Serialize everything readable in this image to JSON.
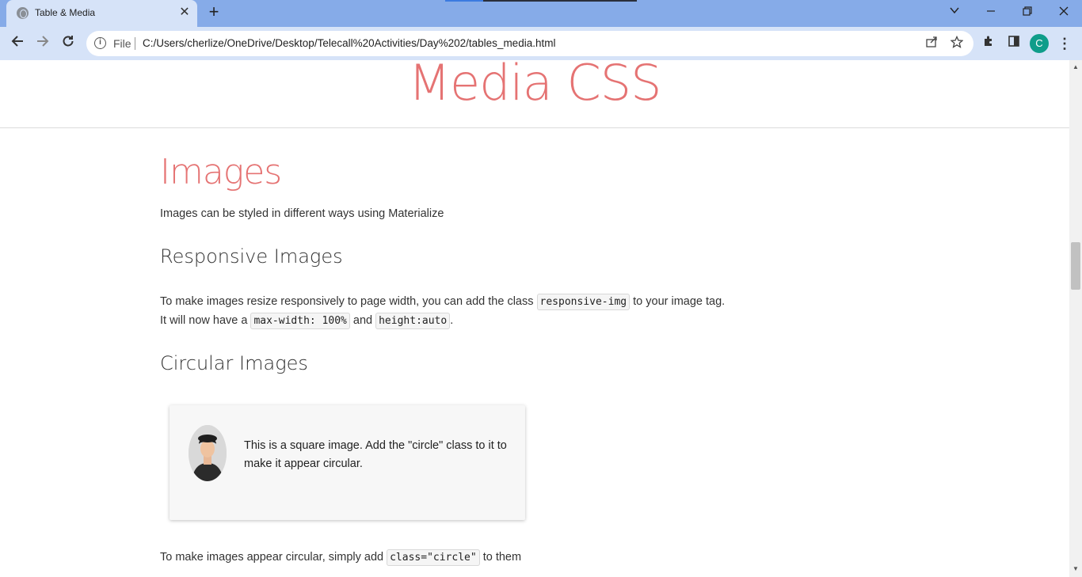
{
  "browser": {
    "tab_title": "Table & Media",
    "tab_close": "✕",
    "new_tab": "+",
    "file_label": "File",
    "url": "C:/Users/cherlize/OneDrive/Desktop/Telecall%20Activities/Day%202/tables_media.html",
    "profile_initial": "C",
    "accent_color": "#86abe8"
  },
  "page": {
    "header_title": "Media CSS",
    "section_title": "Images",
    "intro": "Images can be styled in different ways using Materialize",
    "responsive": {
      "heading": "Responsive Images",
      "line1_before": "To make images resize responsively to page width, you can add the class ",
      "line1_code": "responsive-img",
      "line1_after": " to your image tag.",
      "line2_before": "It will now have a ",
      "line2_code1": "max-width: 100%",
      "line2_mid": " and ",
      "line2_code2": "height:auto",
      "line2_after": "."
    },
    "circular": {
      "heading": "Circular Images",
      "card_text": "This is a square image. Add the \"circle\" class to it to make it appear circular.",
      "note_before": "To make images appear circular, simply add ",
      "note_code": "class=\"circle\"",
      "note_after": " to them"
    },
    "accent_color": "#e57373"
  }
}
